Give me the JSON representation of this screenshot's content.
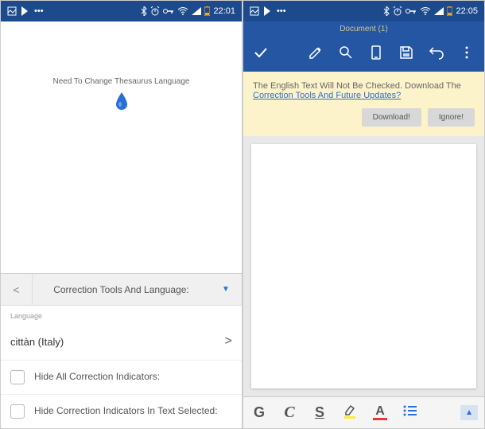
{
  "left": {
    "status": {
      "time": "22:01"
    },
    "main_text": "Need To Change Thesaurus Language",
    "panel": {
      "back": "<",
      "title": "Correction Tools And Language:",
      "chevron": "▼"
    },
    "language": {
      "label": "Language",
      "value": "cittàn (Italy)",
      "chevron": ">"
    },
    "checkboxes": {
      "hide_all": "Hide All Correction Indicators:",
      "hide_selected": "Hide Correction Indicators In Text Selected:"
    }
  },
  "right": {
    "status": {
      "time": "22:05"
    },
    "doc_title": "Document (1)",
    "banner": {
      "text": "The English Text Will Not Be Checked. Download The",
      "link": "Correction Tools And Future Updates?",
      "download": "Download!",
      "ignore": "Ignore!"
    },
    "format": {
      "bold": "G",
      "italic": "C",
      "underline": "S"
    }
  }
}
